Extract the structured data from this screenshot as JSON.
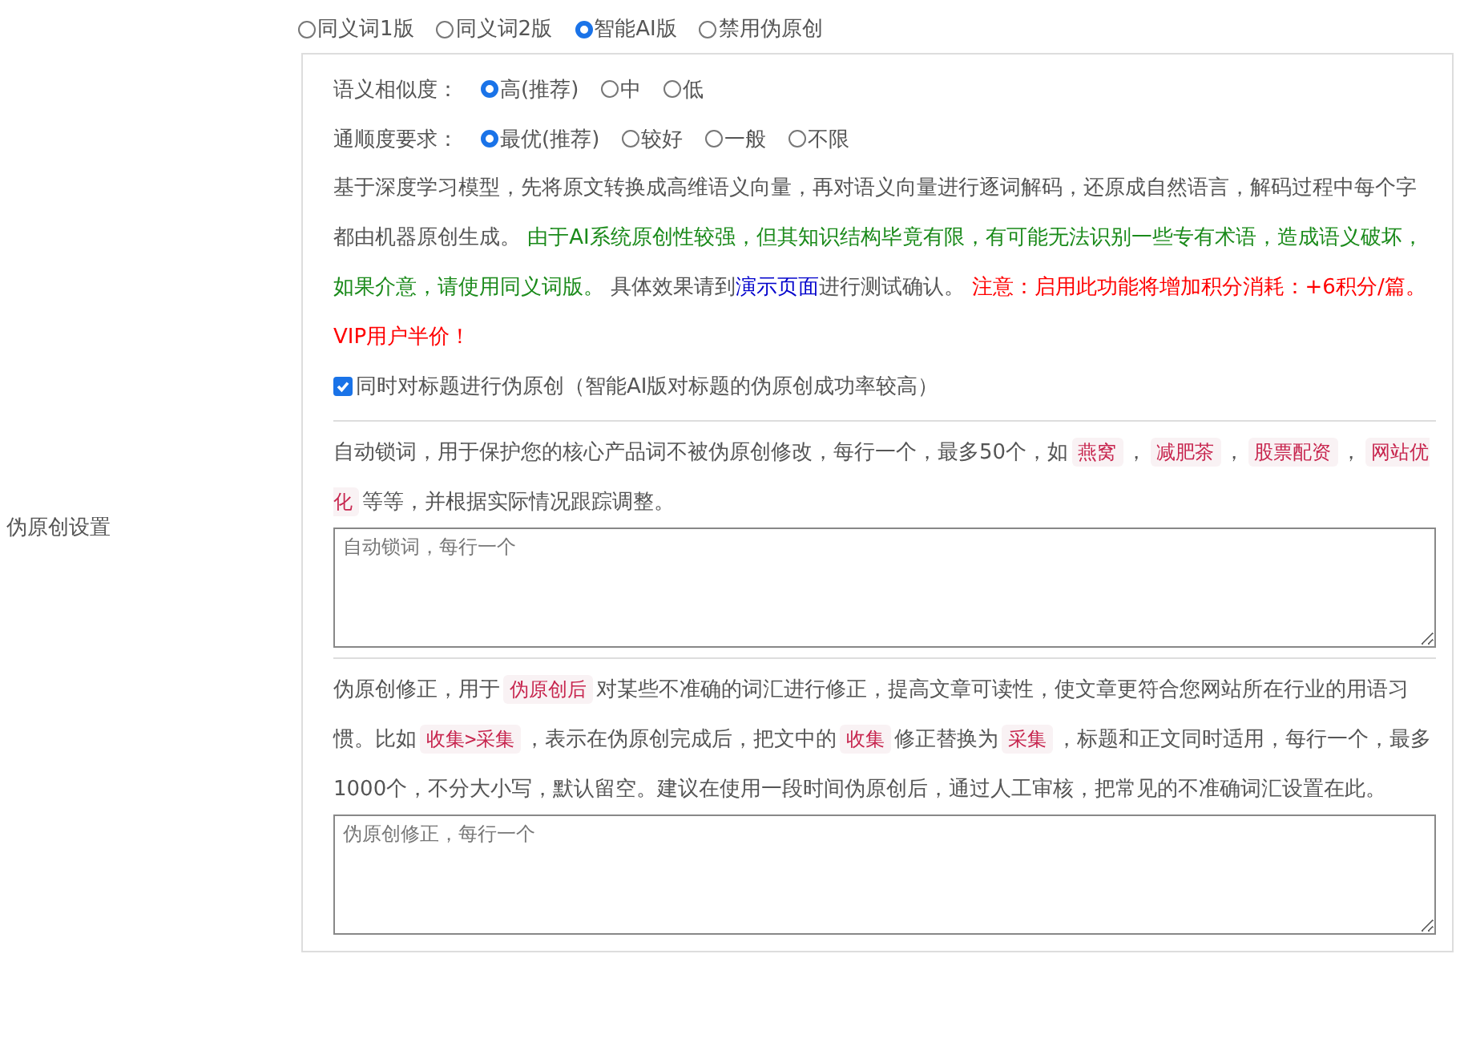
{
  "section_label": "伪原创设置",
  "modes": [
    {
      "label": "同义词1版",
      "selected": false
    },
    {
      "label": "同义词2版",
      "selected": false
    },
    {
      "label": "智能AI版",
      "selected": true
    },
    {
      "label": "禁用伪原创",
      "selected": false
    }
  ],
  "similarity": {
    "label": "语义相似度：",
    "options": [
      {
        "label": "高(推荐)",
        "selected": true
      },
      {
        "label": "中",
        "selected": false
      },
      {
        "label": "低",
        "selected": false
      }
    ]
  },
  "fluency": {
    "label": "通顺度要求：",
    "options": [
      {
        "label": "最优(推荐)",
        "selected": true
      },
      {
        "label": "较好",
        "selected": false
      },
      {
        "label": "一般",
        "selected": false
      },
      {
        "label": "不限",
        "selected": false
      }
    ]
  },
  "ai_description": [
    {
      "kind": "text",
      "text": "基于深度学习模型，先将原文转换成高维语义向量，再对语义向量进行逐词解码，还原成自然语言，解码过程中每个字都由机器原创生成。 "
    },
    {
      "kind": "green",
      "text": "由于AI系统原创性较强，但其知识结构毕竟有限，有可能无法识别一些专有术语，造成语义破坏，如果介意，请使用同义词版。"
    },
    {
      "kind": "text",
      "text": " 具体效果请到"
    },
    {
      "kind": "link",
      "text": "演示页面"
    },
    {
      "kind": "text",
      "text": "进行测试确认。 "
    },
    {
      "kind": "red",
      "text": "注意：启用此功能将增加积分消耗：+6积分/篇。VIP用户半价！"
    }
  ],
  "title_option": {
    "label": "同时对标题进行伪原创（智能AI版对标题的伪原创成功率较高）",
    "checked": true
  },
  "lock_words": {
    "description": [
      {
        "kind": "text",
        "text": "自动锁词，用于保护您的核心产品词不被伪原创修改，每行一个，最多50个，如"
      },
      {
        "kind": "tag",
        "text": "燕窝"
      },
      {
        "kind": "text",
        "text": "，"
      },
      {
        "kind": "tag",
        "text": "减肥茶"
      },
      {
        "kind": "text",
        "text": "，"
      },
      {
        "kind": "tag",
        "text": "股票配资"
      },
      {
        "kind": "text",
        "text": "，"
      },
      {
        "kind": "tag",
        "text": "网站优化"
      },
      {
        "kind": "text",
        "text": "等等，并根据实际情况跟踪调整。"
      }
    ],
    "placeholder": "自动锁词，每行一个"
  },
  "corrections": {
    "description": [
      {
        "kind": "text",
        "text": "伪原创修正，用于"
      },
      {
        "kind": "tag",
        "text": "伪原创后"
      },
      {
        "kind": "text",
        "text": "对某些不准确的词汇进行修正，提高文章可读性，使文章更符合您网站所在行业的用语习惯。比如"
      },
      {
        "kind": "tag",
        "text": "收集>采集"
      },
      {
        "kind": "text",
        "text": "，表示在伪原创完成后，把文中的"
      },
      {
        "kind": "tag",
        "text": "收集"
      },
      {
        "kind": "text",
        "text": "修正替换为"
      },
      {
        "kind": "tag",
        "text": "采集"
      },
      {
        "kind": "text",
        "text": "，标题和正文同时适用，每行一个，最多1000个，不分大小写，默认留空。建议在使用一段时间伪原创后，通过人工审核，把常见的不准确词汇设置在此。"
      }
    ],
    "placeholder": "伪原创修正，每行一个"
  }
}
